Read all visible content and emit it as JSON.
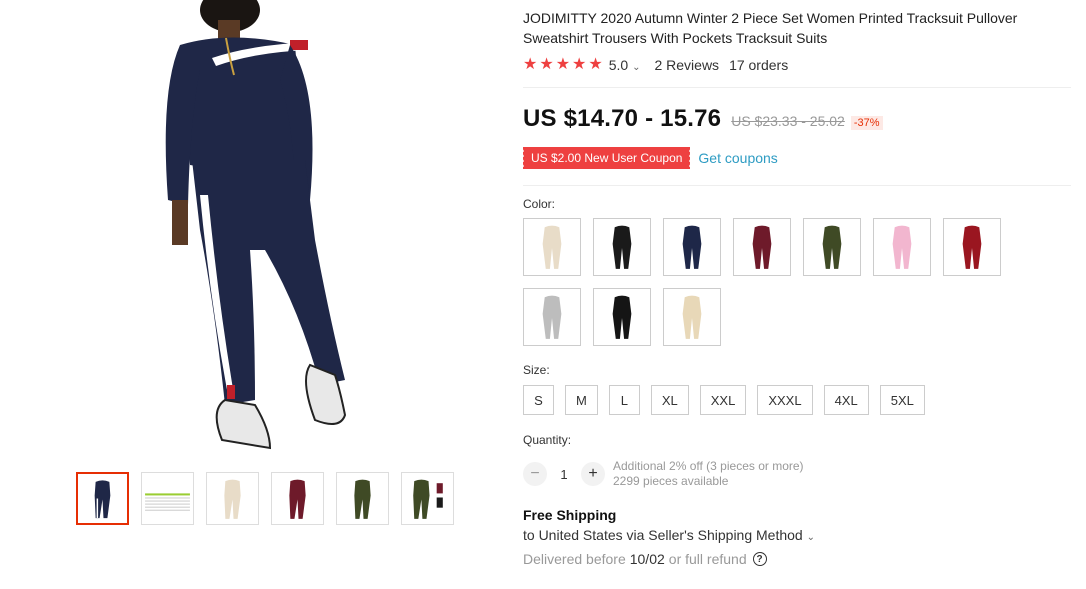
{
  "product": {
    "title": "JODIMITTY 2020 Autumn Winter 2 Piece Set Women Printed Tracksuit Pullover Sweatshirt Trousers With Pockets Tracksuit Suits",
    "rating": "5.0",
    "reviews": "2 Reviews",
    "orders": "17 orders",
    "price": "US $14.70 - 15.76",
    "old_price": "US $23.33 - 25.02",
    "discount": "-37%",
    "coupon": "US $2.00 New User Coupon",
    "get_coupons": "Get coupons"
  },
  "color": {
    "label": "Color:",
    "options": [
      {
        "name": "beige",
        "hex": "#e8dcc8"
      },
      {
        "name": "black",
        "hex": "#1a1a1a"
      },
      {
        "name": "navy",
        "hex": "#1e2748"
      },
      {
        "name": "wine",
        "hex": "#6e1a2a"
      },
      {
        "name": "army-green",
        "hex": "#3f4a25"
      },
      {
        "name": "pink",
        "hex": "#f2b6cf"
      },
      {
        "name": "red",
        "hex": "#9a1620"
      },
      {
        "name": "gray",
        "hex": "#bdbdbd"
      },
      {
        "name": "black-red",
        "hex": "#151515"
      },
      {
        "name": "khaki",
        "hex": "#e8d8b8"
      }
    ]
  },
  "size": {
    "label": "Size:",
    "options": [
      "S",
      "M",
      "L",
      "XL",
      "XXL",
      "XXXL",
      "4XL",
      "5XL"
    ]
  },
  "quantity": {
    "label": "Quantity:",
    "value": "1",
    "minus": "−",
    "plus": "+",
    "discount_note": "Additional 2% off (3 pieces or more)",
    "available": "2299 pieces available"
  },
  "shipping": {
    "title": "Free Shipping",
    "destination": "to United States via Seller's Shipping Method",
    "delivered_prefix": "Delivered before",
    "date": "10/02",
    "delivered_suffix": "or full refund",
    "help": "?"
  },
  "colors": {
    "accent": "#ee4040",
    "link": "#2e9cc3",
    "active_thumb": "#e62e04"
  },
  "icons": {
    "star": "★",
    "caret": "⌄"
  }
}
